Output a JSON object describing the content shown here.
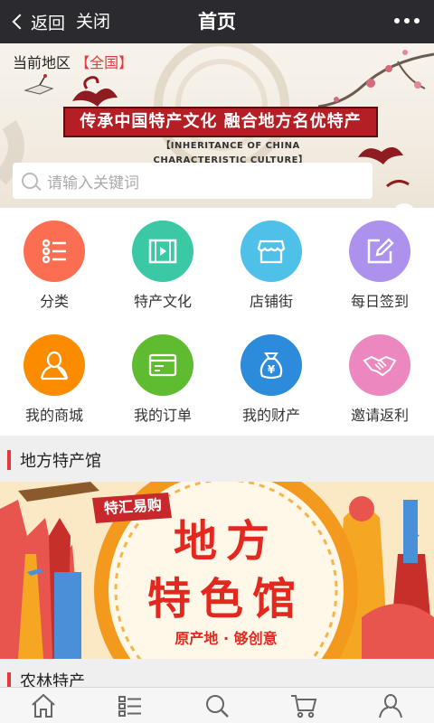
{
  "nav": {
    "back_label": "返回",
    "close_label": "关闭",
    "title": "首页"
  },
  "banner": {
    "region_label": "当前地区",
    "region_value": "【全国】",
    "slogan": "传承中国特产文化 融合地方名优特产",
    "subslogan": "【INHERITANCE OF CHINA CHARACTERISTIC CULTURE】"
  },
  "search": {
    "placeholder": "请输入关键词"
  },
  "features": [
    {
      "label": "分类",
      "icon": "list-icon",
      "color": "#fc6e51"
    },
    {
      "label": "特产文化",
      "icon": "video-icon",
      "color": "#3ac8a5"
    },
    {
      "label": "店铺街",
      "icon": "shop-icon",
      "color": "#4fc1e9"
    },
    {
      "label": "每日签到",
      "icon": "edit-icon",
      "color": "#ac92ec"
    },
    {
      "label": "我的商城",
      "icon": "user-icon",
      "color": "#fb8c00"
    },
    {
      "label": "我的订单",
      "icon": "card-icon",
      "color": "#5fbb2f"
    },
    {
      "label": "我的财产",
      "icon": "money-bag-icon",
      "color": "#2d8bdc"
    },
    {
      "label": "邀请返利",
      "icon": "handshake-icon",
      "color": "#ec87c0"
    }
  ],
  "sections": {
    "local": "地方特产馆",
    "farm": "农林特产"
  },
  "promo": {
    "tag": "特汇易购",
    "line1": "地方",
    "line2": "特色馆",
    "caption": "原产地 · 够创意"
  },
  "tabs": [
    {
      "icon": "home-icon"
    },
    {
      "icon": "category-icon"
    },
    {
      "icon": "search-icon"
    },
    {
      "icon": "cart-icon"
    },
    {
      "icon": "profile-icon"
    }
  ],
  "colors": {
    "accent": "#e4393c",
    "topbar": "#2b2b2f",
    "banner_red": "#b31f24"
  }
}
